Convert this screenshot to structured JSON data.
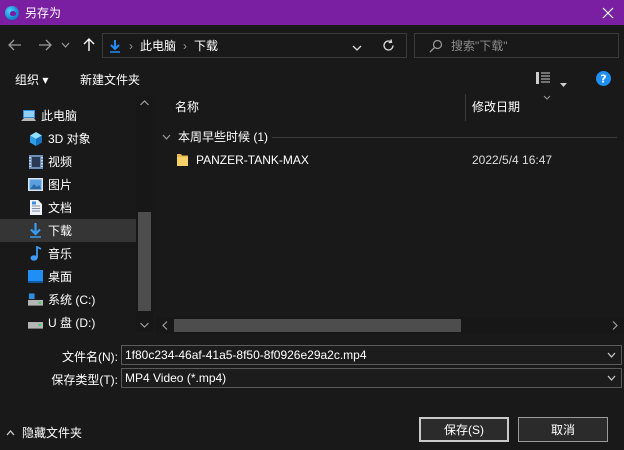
{
  "window": {
    "title": "另存为"
  },
  "nav": {
    "breadcrumb": [
      "此电脑",
      "下载"
    ],
    "search_placeholder": "搜索\"下载\""
  },
  "toolbar": {
    "organize_label": "组织 ▾",
    "new_folder_label": "新建文件夹"
  },
  "sidebar": {
    "items": [
      {
        "label": "此电脑",
        "icon": "computer-icon"
      },
      {
        "label": "3D 对象",
        "icon": "cube-icon"
      },
      {
        "label": "视频",
        "icon": "video-icon"
      },
      {
        "label": "图片",
        "icon": "picture-icon"
      },
      {
        "label": "文档",
        "icon": "document-icon"
      },
      {
        "label": "下载",
        "icon": "download-icon",
        "selected": true
      },
      {
        "label": "音乐",
        "icon": "music-icon"
      },
      {
        "label": "桌面",
        "icon": "desktop-icon"
      },
      {
        "label": "系统 (C:)",
        "icon": "drive-icon"
      },
      {
        "label": "U 盘 (D:)",
        "icon": "drive-icon"
      }
    ]
  },
  "list": {
    "columns": [
      "名称",
      "修改日期"
    ],
    "group": {
      "label": "本周早些时候 (1)"
    },
    "files": [
      {
        "name": "PANZER-TANK-MAX",
        "date": "2022/5/4 16:47",
        "icon": "folder-icon"
      }
    ]
  },
  "form": {
    "filename_label": "文件名(N):",
    "filename_value": "1f80c234-46af-41a5-8f50-8f0926e29a2c.mp4",
    "filetype_label": "保存类型(T):",
    "filetype_value": "MP4 Video (*.mp4)"
  },
  "footer": {
    "hide_folders_label": "隐藏文件夹",
    "save_label": "保存(S)",
    "cancel_label": "取消"
  },
  "colors": {
    "titlebar": "#7b1fa2",
    "background": "#191919",
    "accent": "#1f8ff5"
  }
}
